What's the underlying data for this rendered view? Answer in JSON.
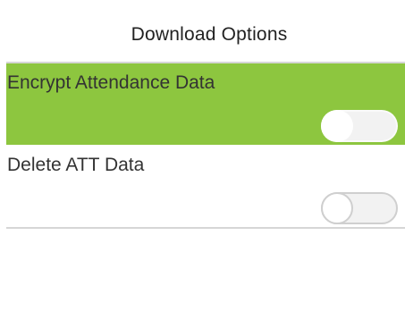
{
  "title": "Download Options",
  "options": [
    {
      "label": "Encrypt Attendance Data",
      "enabled": false,
      "selected": true
    },
    {
      "label": "Delete ATT Data",
      "enabled": false,
      "selected": false
    }
  ],
  "colors": {
    "selected_row_bg": "#8dc63f",
    "row_bg": "#ffffff",
    "divider": "#d6d6d6",
    "toggle_off_track": "#f2f2f2",
    "toggle_off_border": "#cfcfcf",
    "toggle_knob": "#ffffff",
    "text": "#333333"
  }
}
